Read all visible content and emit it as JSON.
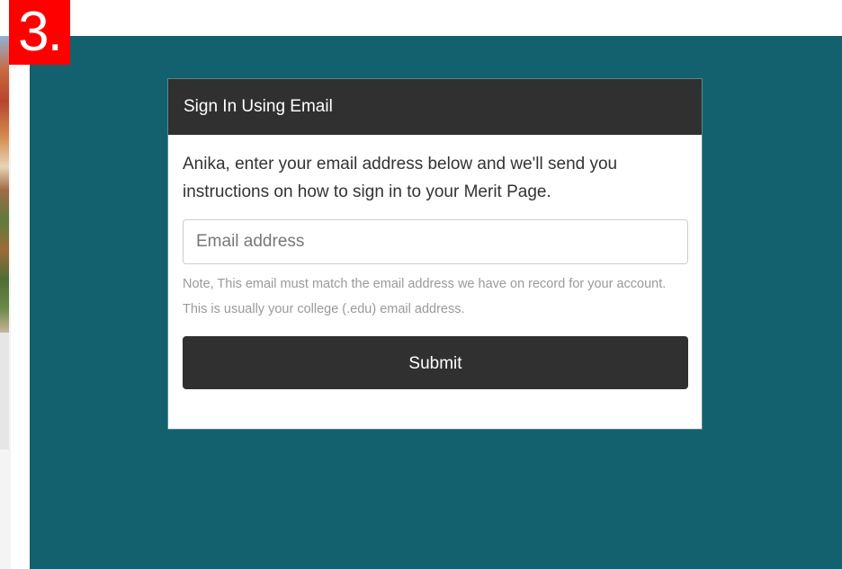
{
  "step_badge": "3.",
  "modal": {
    "title": "Sign In Using Email",
    "intro": "Anika, enter your email address below and we'll send you instructions on how to sign in to your Merit Page.",
    "email_input": {
      "value": "",
      "placeholder": "Email address"
    },
    "note": "Note, This email must match the email address we have on record for your account. This is usually your college (.edu) email address.",
    "submit_label": "Submit"
  },
  "colors": {
    "background_panel": "#13616f",
    "header": "#303030",
    "button": "#303030",
    "badge": "#ff0000"
  }
}
